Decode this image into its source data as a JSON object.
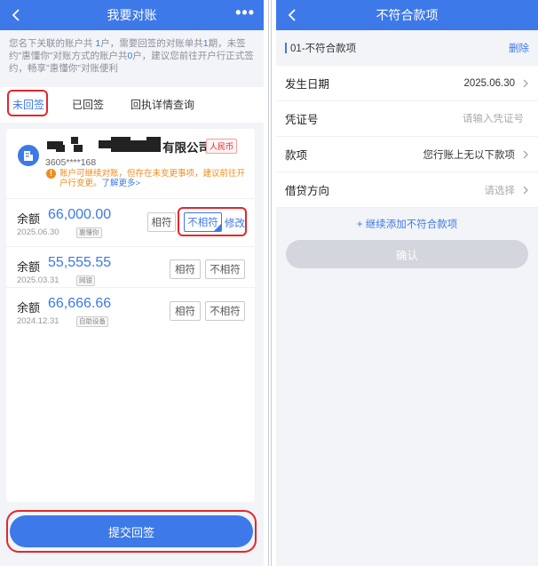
{
  "left": {
    "navbar": {
      "title": "我要对账",
      "more": "•••"
    },
    "notice": {
      "p1": "您名下关联的账户共 ",
      "acct_count": "1",
      "p2": "户，需要回签的对账单共",
      "stmt_count": "1",
      "p3": "期，未签约\"惠懂你\"对账方式的账户共",
      "unsigned_count": "0",
      "p4": "户，建议您前往开户行正式签约，畅享\"惠懂你\"对账便利"
    },
    "tabs": [
      "未回签",
      "已回签",
      "回执详情查询"
    ],
    "account": {
      "company_suffix": "有限公司",
      "currency": "人民币",
      "number": "3605****168",
      "warning": "账户可继续对账，但存在未变更事项，建议前往开户行变更。",
      "learn_more": "了解更多>"
    },
    "records": [
      {
        "label": "余额",
        "amount": "66,000.00",
        "date": "2025.06.30",
        "tag": "惠懂你",
        "match": "相符",
        "mismatch": "不相符",
        "modify": "修改"
      },
      {
        "label": "余额",
        "amount": "55,555.55",
        "date": "2025.03.31",
        "tag": "网银",
        "match": "相符",
        "mismatch": "不相符"
      },
      {
        "label": "余额",
        "amount": "66,666.66",
        "date": "2024.12.31",
        "tag": "自助设备",
        "match": "相符",
        "mismatch": "不相符"
      }
    ],
    "submit": "提交回签"
  },
  "right": {
    "navbar": {
      "title": "不符合款项"
    },
    "section": {
      "title": "01-不符合款项",
      "delete": "删除"
    },
    "fields": {
      "date": {
        "label": "发生日期",
        "value": "2025.06.30"
      },
      "voucher": {
        "label": "凭证号",
        "placeholder": "请输入凭证号"
      },
      "item": {
        "label": "款项",
        "value": "您行账上无以下款项"
      },
      "direction": {
        "label": "借贷方向",
        "value": "请选择"
      }
    },
    "add": "+ 继续添加不符合款项",
    "confirm": "确认"
  },
  "colors": {
    "primary": "#3d79e9",
    "highlight_box": "#e5262a",
    "warning": "#f08c1a",
    "disabled": "#d3d6dd"
  },
  "icons": [
    "back-arrow-icon",
    "more-icon",
    "building-icon",
    "warning-icon",
    "chevron-right-icon"
  ]
}
